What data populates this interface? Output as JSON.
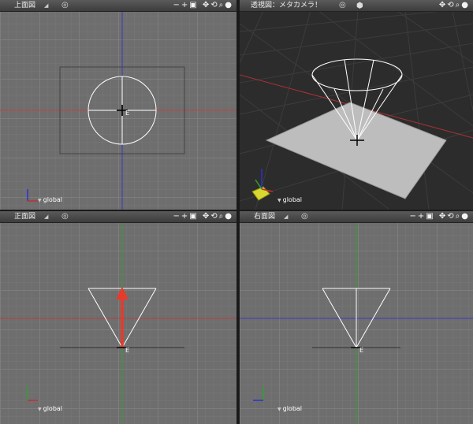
{
  "viewports": {
    "top": {
      "title": "上面図",
      "space": "global"
    },
    "perspective": {
      "title": "透視図：メタカメラ！",
      "space": "global"
    },
    "front": {
      "title": "正面図",
      "space": "global"
    },
    "right": {
      "title": "右面図",
      "space": "global"
    }
  },
  "icons": {
    "menu": "▾",
    "target": "◎",
    "cube": "⬢",
    "zoom_out": "−",
    "zoom_in": "+",
    "camera": "camera-icon",
    "pan": "✥",
    "rotate": "⟲",
    "magnify": "🔍",
    "sphere": "●"
  },
  "colors": {
    "x_axis": "#d03030",
    "y_axis": "#30a030",
    "z_axis": "#3030d0",
    "move_arrow": "#e83a2a",
    "wire": "#ffffff"
  }
}
